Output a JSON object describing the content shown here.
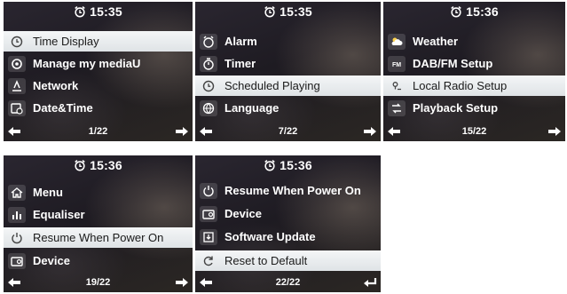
{
  "colors": {
    "highlight": "#e8ebed",
    "text": "#ffffff",
    "selected_text": "#1b1b1b"
  },
  "panels": [
    {
      "time": "15:35",
      "items": [
        {
          "label": "Time Display",
          "icon": "clock-icon",
          "selected": true
        },
        {
          "label": "Manage my mediaU",
          "icon": "media-icon",
          "selected": false
        },
        {
          "label": "Network",
          "icon": "network-icon",
          "selected": false
        },
        {
          "label": "Date&Time",
          "icon": "calendar-clock-icon",
          "selected": false
        }
      ],
      "page": "1/22",
      "left_icon": "arrow-left-icon",
      "right_icon": "arrow-right-icon"
    },
    {
      "time": "15:35",
      "items": [
        {
          "label": "Alarm",
          "icon": "alarm-icon",
          "selected": false
        },
        {
          "label": "Timer",
          "icon": "timer-icon",
          "selected": false
        },
        {
          "label": "Scheduled Playing",
          "icon": "schedule-icon",
          "selected": true
        },
        {
          "label": "Language",
          "icon": "globe-icon",
          "selected": false
        }
      ],
      "page": "7/22",
      "left_icon": "arrow-left-icon",
      "right_icon": "arrow-right-icon"
    },
    {
      "time": "15:36",
      "items": [
        {
          "label": "Weather",
          "icon": "weather-icon",
          "selected": false
        },
        {
          "label": "DAB/FM Setup",
          "icon": "fm-icon",
          "selected": false
        },
        {
          "label": "Local Radio Setup",
          "icon": "location-icon",
          "selected": true
        },
        {
          "label": "Playback Setup",
          "icon": "playback-icon",
          "selected": false
        }
      ],
      "page": "15/22",
      "left_icon": "arrow-left-icon",
      "right_icon": "arrow-right-icon"
    },
    {
      "time": "15:36",
      "items": [
        {
          "label": "Menu",
          "icon": "home-icon",
          "selected": false
        },
        {
          "label": "Equaliser",
          "icon": "equaliser-icon",
          "selected": false
        },
        {
          "label": "Resume When Power On",
          "icon": "resume-icon",
          "selected": true
        },
        {
          "label": "Device",
          "icon": "device-icon",
          "selected": false
        }
      ],
      "page": "19/22",
      "left_icon": "arrow-left-icon",
      "right_icon": "arrow-right-icon"
    },
    {
      "time": "15:36",
      "items": [
        {
          "label": "Resume When Power On",
          "icon": "resume-icon",
          "selected": false
        },
        {
          "label": "Device",
          "icon": "device-icon",
          "selected": false
        },
        {
          "label": "Software Update",
          "icon": "update-icon",
          "selected": false
        },
        {
          "label": "Reset to Default",
          "icon": "reset-icon",
          "selected": true
        }
      ],
      "page": "22/22",
      "left_icon": "arrow-left-icon",
      "right_icon": "enter-icon"
    }
  ]
}
